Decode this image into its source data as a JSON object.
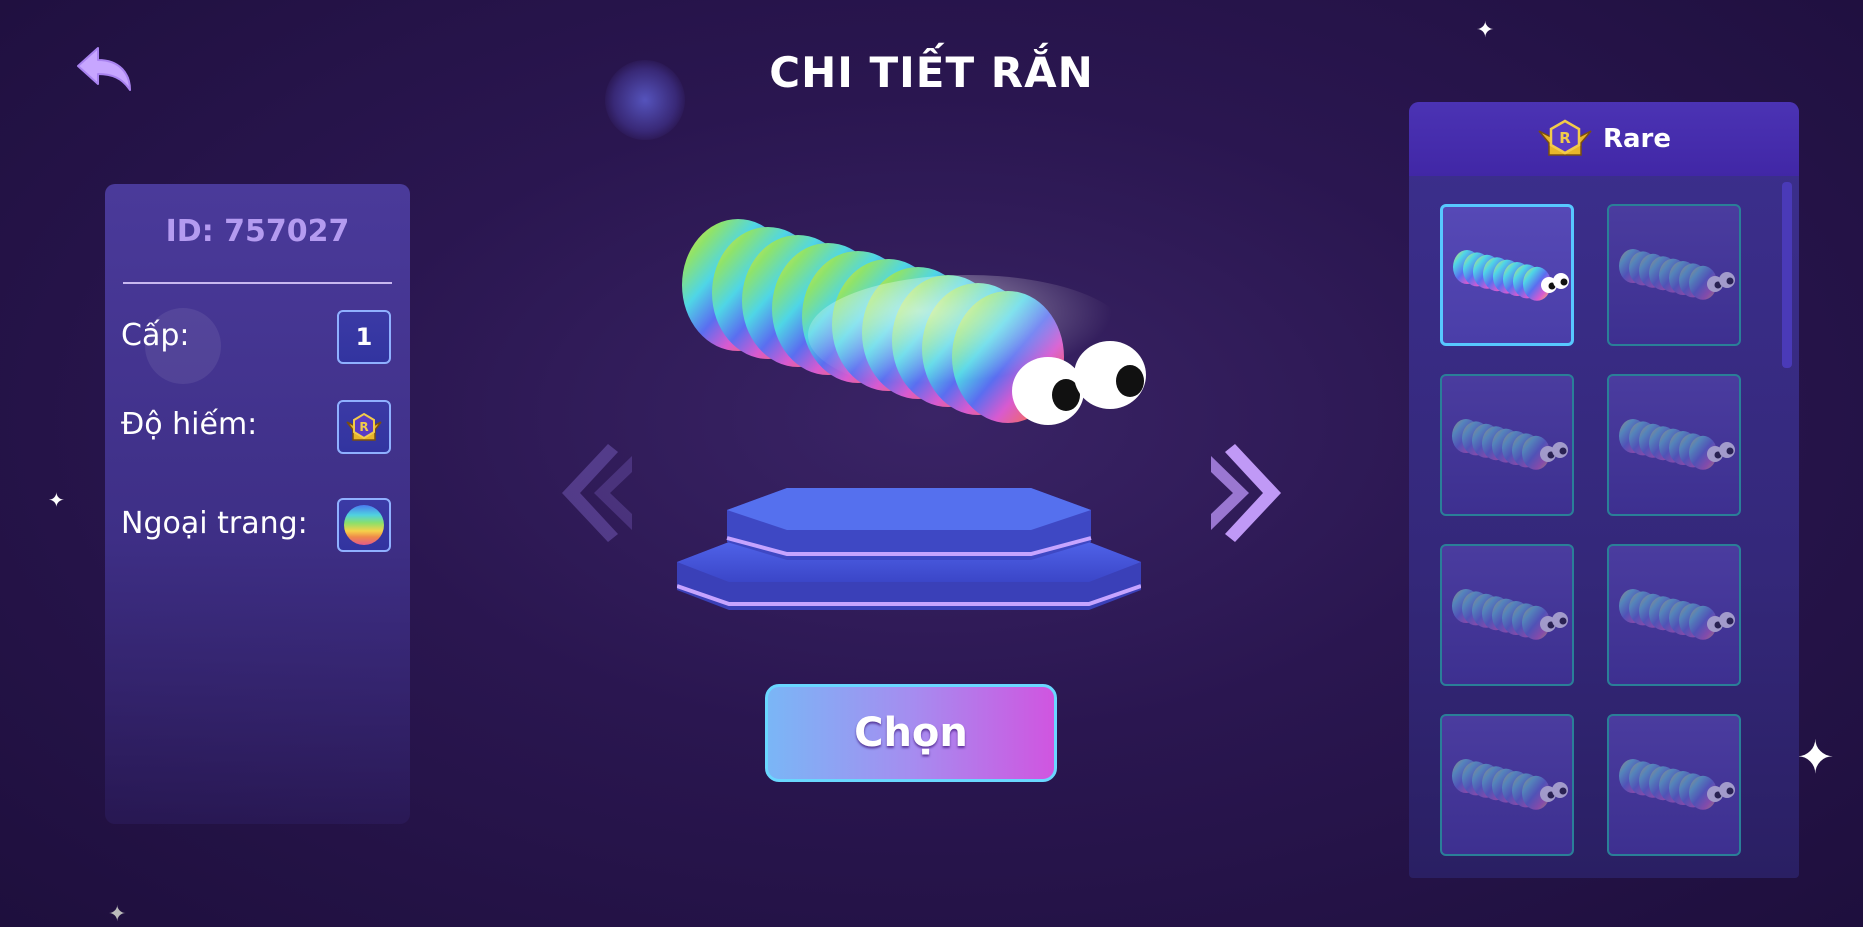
{
  "screen": {
    "title": "CHI TIẾT RẮN"
  },
  "navigation": {
    "back_icon": "back-arrow-icon"
  },
  "details": {
    "id_text": "ID: 757027",
    "level_label": "Cấp:",
    "level_value": "1",
    "rarity_label": "Độ hiếm:",
    "rarity_badge": "R",
    "skin_label": "Ngoại trang:"
  },
  "actions": {
    "select_label": "Chọn"
  },
  "skin_list": {
    "category_label": "Rare",
    "category_badge": "R",
    "items": [
      {
        "selected": true
      },
      {
        "selected": false
      },
      {
        "selected": false
      },
      {
        "selected": false
      },
      {
        "selected": false
      },
      {
        "selected": false
      },
      {
        "selected": false
      },
      {
        "selected": false
      }
    ]
  },
  "colors": {
    "background": "#2a1650",
    "panel": "#4a3a9a",
    "accent_cyan": "#57c8ff",
    "button_gradient_start": "#7ab6f6",
    "button_gradient_end": "#d055e0",
    "id_text": "#b49bf0"
  }
}
